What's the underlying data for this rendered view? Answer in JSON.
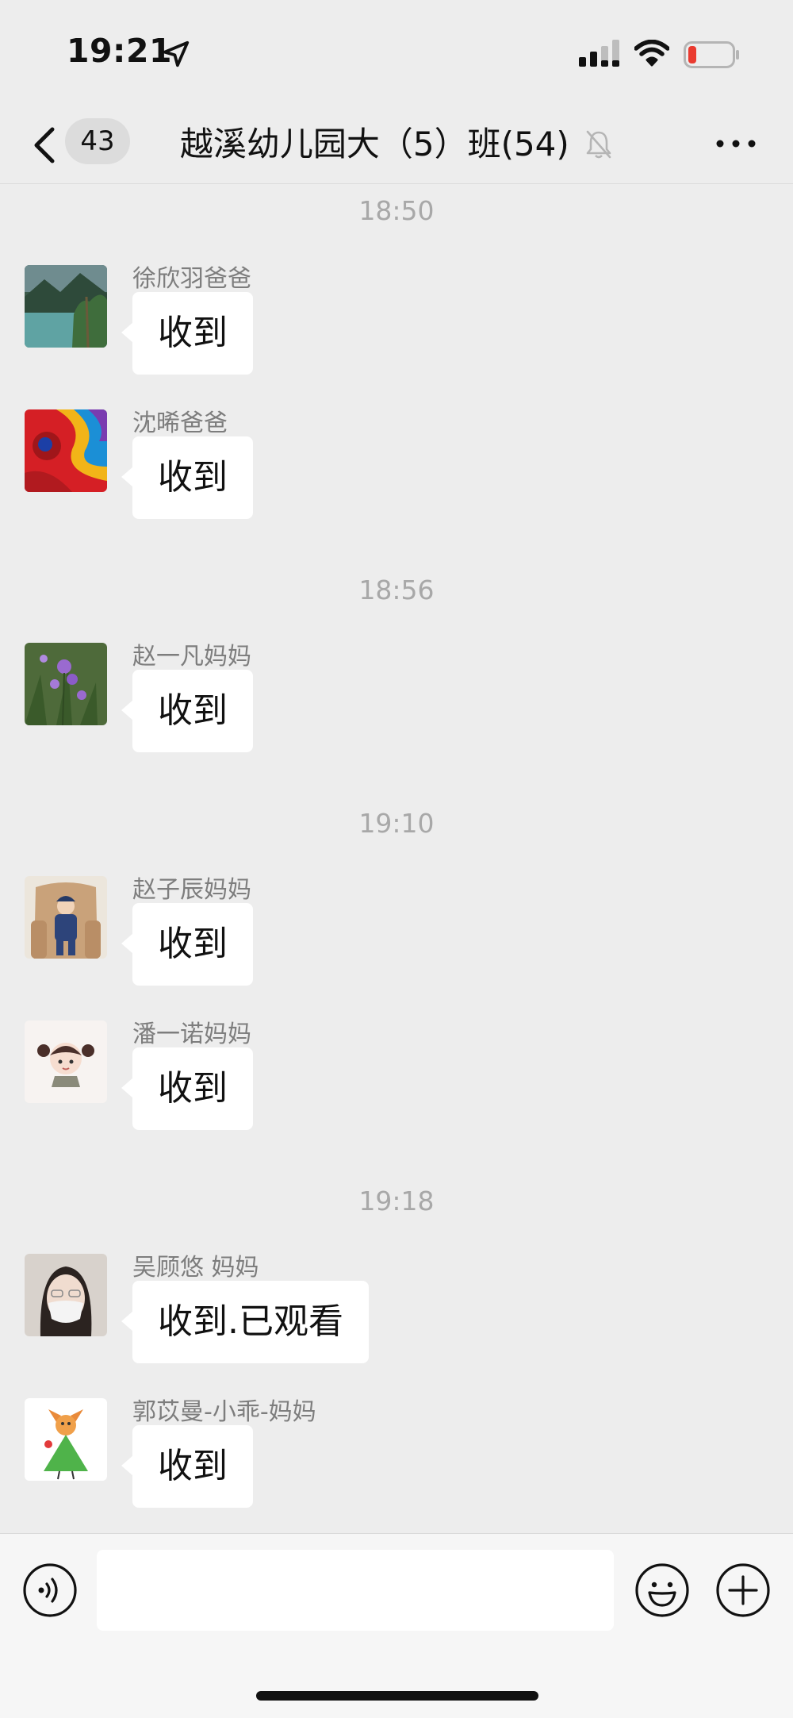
{
  "status_bar": {
    "time": "19:21"
  },
  "nav": {
    "unread_count": "43",
    "title": "越溪幼儿园大（5）班(54)"
  },
  "chat": {
    "time_separators": [
      "18:50",
      "18:56",
      "19:10",
      "19:18"
    ],
    "messages": [
      {
        "sender": "徐欣羽爸爸",
        "text": "收到",
        "avatar": "lake-mountain-photo"
      },
      {
        "sender": "沈晞爸爸",
        "text": "收到",
        "avatar": "colorful-paint-swirl"
      },
      {
        "sender": "赵一凡妈妈",
        "text": "收到",
        "avatar": "purple-flowers-photo"
      },
      {
        "sender": "赵子辰妈妈",
        "text": "收到",
        "avatar": "child-in-armchair-photo"
      },
      {
        "sender": "潘一诺妈妈",
        "text": "收到",
        "avatar": "cartoon-girl-pigtails"
      },
      {
        "sender": "吴顾悠 妈妈",
        "text": "收到.已观看",
        "avatar": "woman-with-mask-photo"
      },
      {
        "sender": "郭苡曼-小乖-妈妈",
        "text": "收到",
        "avatar": "cartoon-fox-green-dress"
      }
    ]
  },
  "input_bar": {
    "input_value": "",
    "input_placeholder": ""
  },
  "colors": {
    "background": "#ededed",
    "bubble": "#ffffff",
    "input_bar": "#f6f6f6",
    "battery_low": "#ea3b30"
  }
}
